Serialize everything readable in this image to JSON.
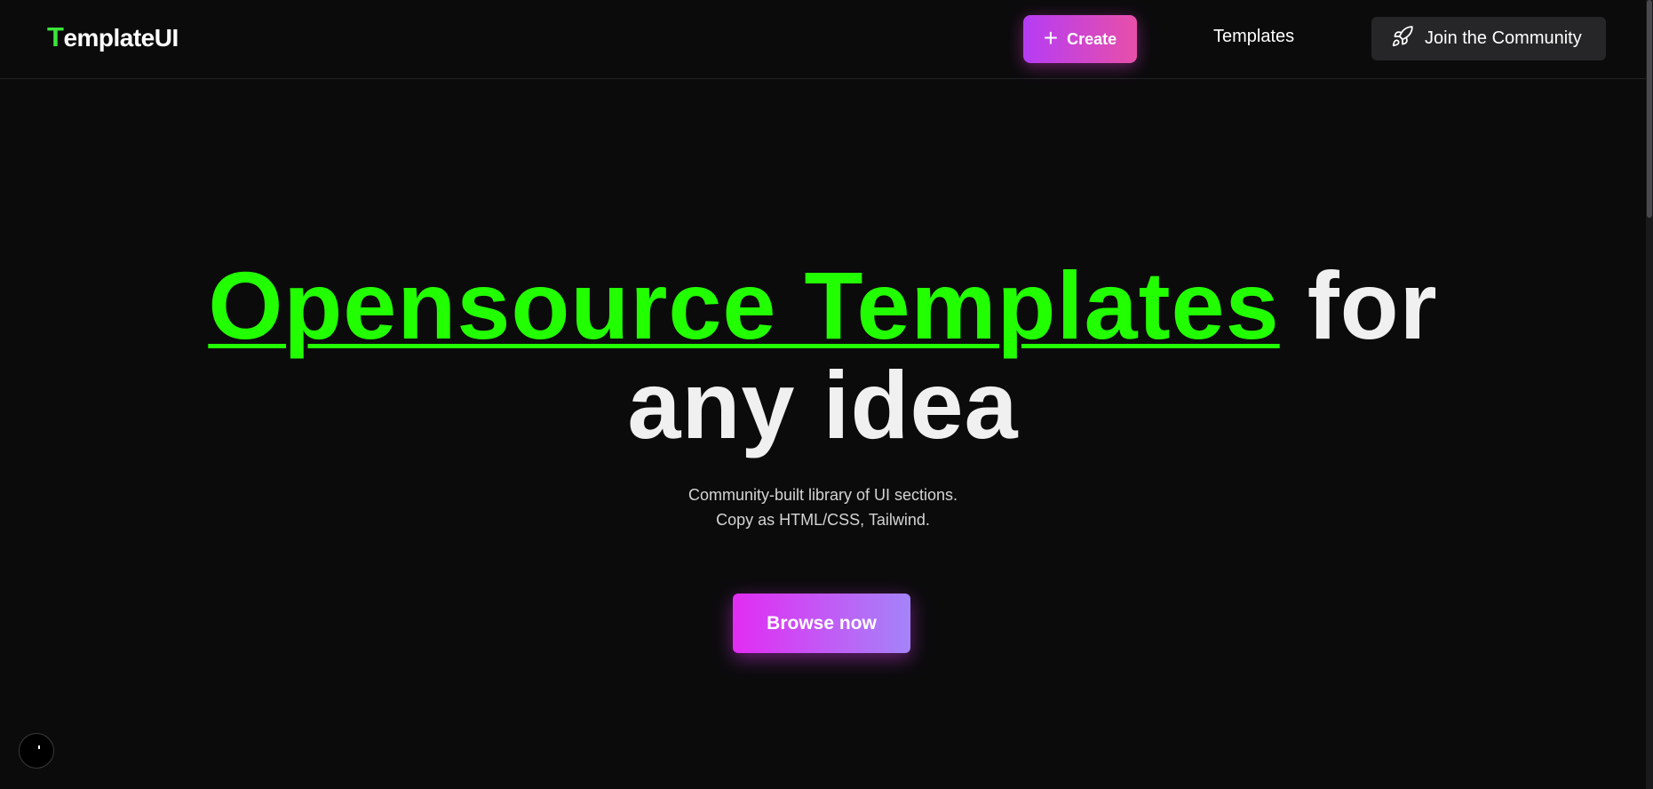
{
  "navbar": {
    "logo_first_letter": "T",
    "logo_rest": "emplateUI",
    "create_label": "Create",
    "templates_label": "Templates",
    "community_label": "Join the Community"
  },
  "hero": {
    "title_accent": "Opensource Templates",
    "title_rest_1": "for",
    "title_rest_2": "any idea",
    "subtitle_line1": "Community-built library of UI sections.",
    "subtitle_line2": "Copy as HTML/CSS, Tailwind.",
    "cta_label": "Browse now"
  },
  "icons": {
    "create": "plus-icon",
    "community": "rocket-icon"
  },
  "colors": {
    "background": "#0b0b0c",
    "accent_green": "#22ff00",
    "logo_green": "#39e639",
    "create_gradient": [
      "#b53cf5",
      "#e84fa8"
    ],
    "browse_gradient": [
      "#e22cf3",
      "#a484f8"
    ]
  }
}
